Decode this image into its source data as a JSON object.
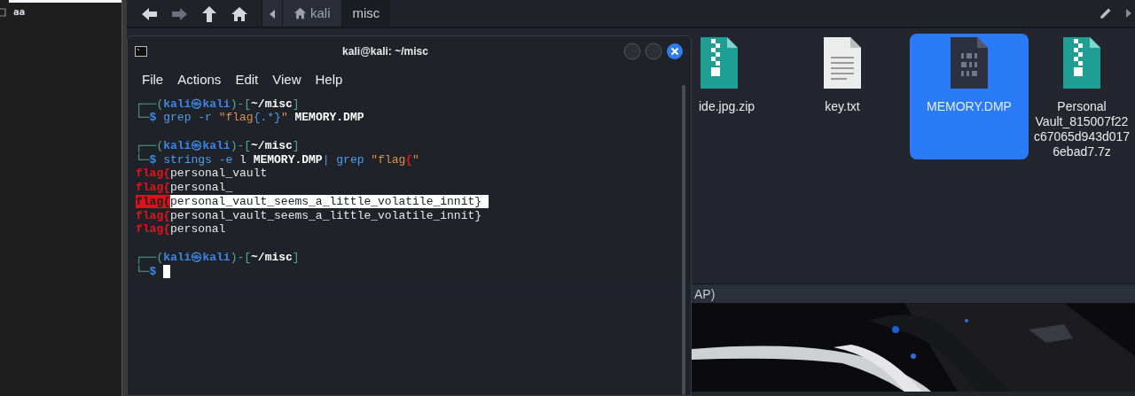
{
  "left_panel": {
    "items": [
      {
        "label": "aa"
      }
    ]
  },
  "file_manager": {
    "nav_buttons": [
      {
        "kind": "back",
        "disabled": false
      },
      {
        "kind": "forward",
        "disabled": true
      },
      {
        "kind": "up",
        "disabled": false
      },
      {
        "kind": "home",
        "disabled": false
      }
    ],
    "breadcrumbs": [
      {
        "label": "kali",
        "kind": "home",
        "selected": false
      },
      {
        "label": "misc",
        "kind": "folder",
        "selected": true
      }
    ],
    "files": [
      {
        "label": "ide.jpg.zip",
        "kind": "zip",
        "selected": false
      },
      {
        "label": "key.txt",
        "kind": "text",
        "selected": false
      },
      {
        "label": "MEMORY.DMP",
        "kind": "binary",
        "selected": true
      },
      {
        "label": "Personal\nVault_815007f22\nc67065d943d017\n6ebad7.7z",
        "kind": "zip",
        "selected": false
      }
    ],
    "status_text": "AP)"
  },
  "terminal": {
    "title": "kali@kali: ~/misc",
    "menu": [
      "File",
      "Actions",
      "Edit",
      "View",
      "Help"
    ],
    "lines": [
      {
        "kind": "text",
        "segments": [
          {
            "kind": "frame",
            "text": "┌──("
          },
          {
            "kind": "user",
            "text": "kali㉿kali"
          },
          {
            "kind": "frame",
            "text": ")-["
          },
          {
            "kind": "path",
            "text": "~/misc"
          },
          {
            "kind": "frame",
            "text": "]"
          }
        ]
      },
      {
        "kind": "text",
        "segments": [
          {
            "kind": "frame",
            "text": "└─"
          },
          {
            "kind": "user",
            "text": "$"
          },
          {
            "kind": "command",
            "text": " grep -r "
          },
          {
            "kind": "string",
            "text": "\"flag"
          },
          {
            "kind": "command",
            "text": "{.*}"
          },
          {
            "kind": "string",
            "text": "\""
          },
          {
            "kind": "path",
            "text": " MEMORY.DMP"
          }
        ]
      },
      {
        "kind": "blank"
      },
      {
        "kind": "text",
        "segments": [
          {
            "kind": "frame",
            "text": "┌──("
          },
          {
            "kind": "user",
            "text": "kali㉿kali"
          },
          {
            "kind": "frame",
            "text": ")-["
          },
          {
            "kind": "path",
            "text": "~/misc"
          },
          {
            "kind": "frame",
            "text": "]"
          }
        ]
      },
      {
        "kind": "text",
        "segments": [
          {
            "kind": "frame",
            "text": "└─"
          },
          {
            "kind": "user",
            "text": "$"
          },
          {
            "kind": "command",
            "text": " strings -e "
          },
          {
            "kind": "plain",
            "text": "l "
          },
          {
            "kind": "path",
            "text": "MEMORY.DMP"
          },
          {
            "kind": "command",
            "text": "| grep "
          },
          {
            "kind": "string",
            "text": "\"flag"
          },
          {
            "kind": "match",
            "text": "{"
          },
          {
            "kind": "string",
            "text": "\""
          }
        ]
      },
      {
        "kind": "text",
        "segments": [
          {
            "kind": "match",
            "text": "flag{"
          },
          {
            "kind": "plain",
            "text": "personal_vault"
          }
        ]
      },
      {
        "kind": "text",
        "segments": [
          {
            "kind": "match",
            "text": "flag{"
          },
          {
            "kind": "plain",
            "text": "personal_"
          }
        ]
      },
      {
        "kind": "text",
        "segments": [
          {
            "kind": "match-selected",
            "text": "flag{"
          },
          {
            "kind": "selected",
            "text": "personal_vault_seems_a_little_volatile_innit} "
          }
        ]
      },
      {
        "kind": "text",
        "segments": [
          {
            "kind": "match",
            "text": "flag{"
          },
          {
            "kind": "plain",
            "text": "personal_vault_seems_a_little_volatile_innit}"
          }
        ]
      },
      {
        "kind": "text",
        "segments": [
          {
            "kind": "match",
            "text": "flag{"
          },
          {
            "kind": "plain",
            "text": "personal"
          }
        ]
      },
      {
        "kind": "blank"
      },
      {
        "kind": "text",
        "segments": [
          {
            "kind": "frame",
            "text": "┌──("
          },
          {
            "kind": "user",
            "text": "kali㉿kali"
          },
          {
            "kind": "frame",
            "text": ")-["
          },
          {
            "kind": "path",
            "text": "~/misc"
          },
          {
            "kind": "frame",
            "text": "]"
          }
        ]
      },
      {
        "kind": "text",
        "cursor": true,
        "segments": [
          {
            "kind": "frame",
            "text": "└─"
          },
          {
            "kind": "user",
            "text": "$ "
          }
        ]
      }
    ]
  }
}
